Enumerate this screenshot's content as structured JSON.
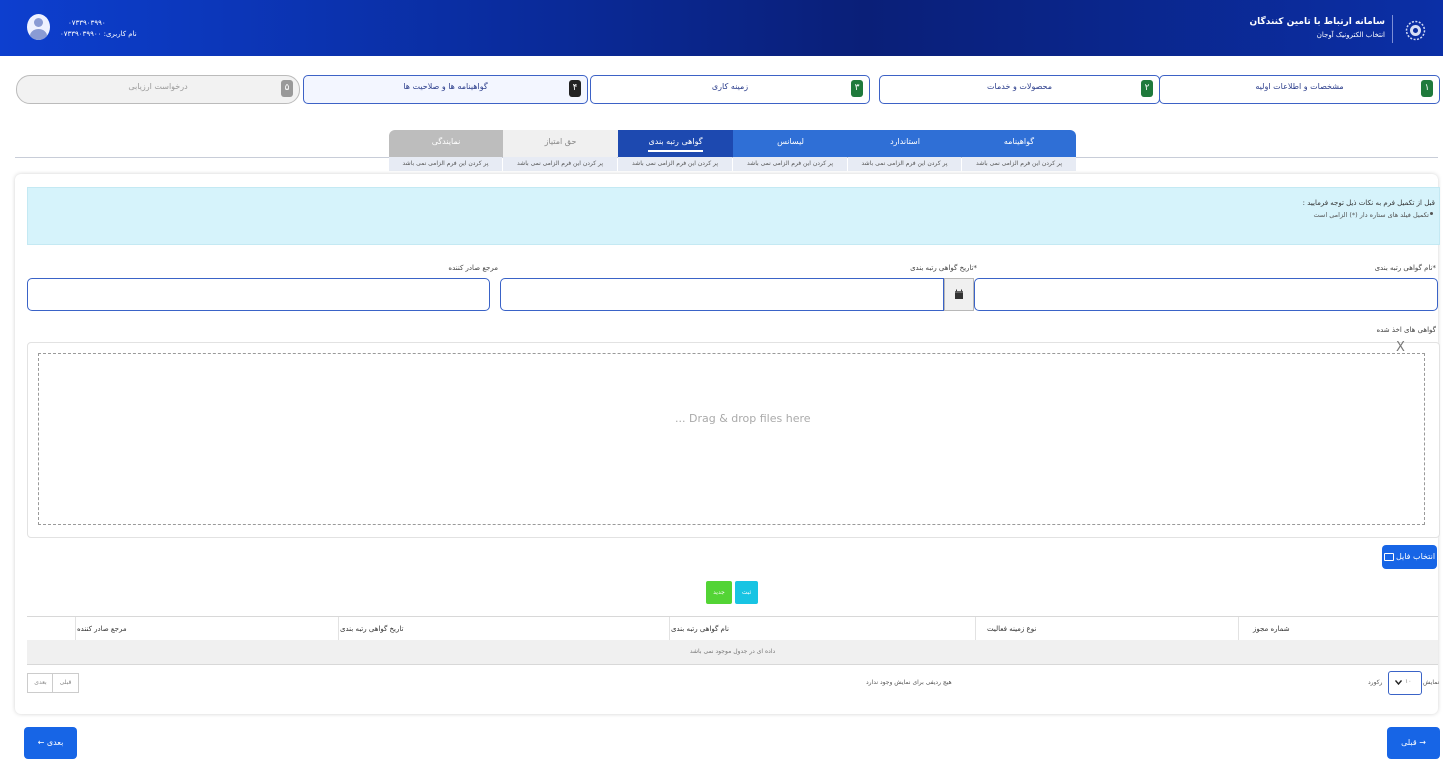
{
  "header": {
    "system_title": "سامانه ارتباط با تامین کنندگان",
    "system_subtitle": "انتخاب الکترونیک آوجان",
    "user_phone": "۰۷۳۳۹۰۳۹۹۰",
    "user_name": "نام کاربری: ۰۷۳۳۹۰۳۹۹۰۰",
    "brand_color": "#0a2c9e"
  },
  "steps": [
    {
      "num": "۱",
      "label": "مشخصات و اطلاعات اولیه",
      "state": "done"
    },
    {
      "num": "۲",
      "label": "محصولات و خدمات",
      "state": "done"
    },
    {
      "num": "۳",
      "label": "زمینه کاری",
      "state": "done"
    },
    {
      "num": "۴",
      "label": "گواهینامه ها و صلاحیت ها",
      "state": "current"
    },
    {
      "num": "۵",
      "label": "درخواست ارزیابی",
      "state": "disabled"
    }
  ],
  "tabs": [
    {
      "label": "گواهینامه",
      "sub": "پر کردن این فرم الزامی نمی باشد"
    },
    {
      "label": "استاندارد",
      "sub": "پر کردن این فرم الزامی نمی باشد"
    },
    {
      "label": "لیسانس",
      "sub": "پر کردن این فرم الزامی نمی باشد"
    },
    {
      "label": "گواهی رتبه بندی",
      "sub": "پر کردن این فرم الزامی نمی باشد"
    },
    {
      "label": "حق امتیاز",
      "sub": "پر کردن این فرم الزامی نمی باشد"
    },
    {
      "label": "نمایندگی",
      "sub": "پر کردن این فرم الزامی نمی باشد"
    }
  ],
  "alert": {
    "title": "قبل از تکمیل فرم به نکات ذیل توجه فرمایید :",
    "bullet": "تکمیل فیلد های ستاره دار (*) الزامی است"
  },
  "form": {
    "cert_name_label": "*نام گواهی رتبه بندی",
    "cert_date_label": "*تاریخ گواهی رتبه بندی",
    "issuer_label": "مرجع صادر کننده",
    "files_label": "گواهی های اخذ شده",
    "drop_text": "... Drag & drop files here",
    "close_glyph": "X",
    "select_file_label": "انتخاب فایل"
  },
  "actions": {
    "save_label": "ثبت",
    "new_label": "جدید"
  },
  "table": {
    "columns": [
      "شماره مجوز",
      "نوع زمینه فعالیت",
      "نام گواهی رتبه بندی",
      "تاریخ گواهی رتبه بندی",
      "مرجع صادر کننده"
    ],
    "empty_message": "داده ای در جدول موجود نمی باشد",
    "info_text": "هیچ ردیفی برای نمایش وجود ندارد",
    "show_label": "نمایش",
    "page_size": "۱۰",
    "records_label": "رکورد",
    "prev_page": "قبلی",
    "next_page": "بعدی"
  },
  "footer": {
    "next_label": "بعدی",
    "prev_label": "قبلی"
  }
}
